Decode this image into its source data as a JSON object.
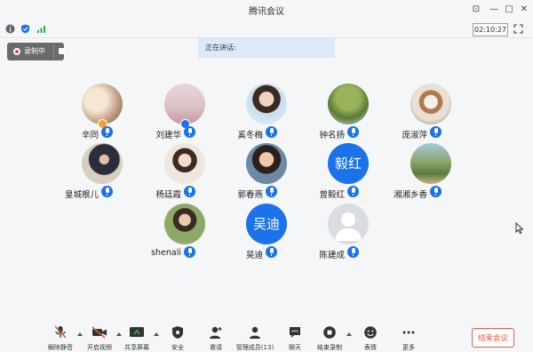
{
  "window": {
    "title": "腾讯会议"
  },
  "window_controls": {
    "pin": "⊡",
    "minimize": "—",
    "maximize": "□",
    "close": "✕"
  },
  "status": {
    "clock": "02:10:27"
  },
  "recording": {
    "label": "录制中"
  },
  "speaking": {
    "label": "正在讲话:"
  },
  "participants": [
    {
      "name": "辛同",
      "avatar": "photo",
      "muted": false,
      "badge": "host"
    },
    {
      "name": "刘建华",
      "avatar": "photo",
      "muted": false,
      "badge": "co-host"
    },
    {
      "name": "奚冬梅",
      "avatar": "photo",
      "muted": false
    },
    {
      "name": "钟名扬",
      "avatar": "photo",
      "muted": false
    },
    {
      "name": "庞淑萍",
      "avatar": "photo",
      "muted": false
    },
    {
      "name": "皇城根儿",
      "avatar": "photo",
      "muted": false
    },
    {
      "name": "杨廷霞",
      "avatar": "photo",
      "muted": false
    },
    {
      "name": "郭春燕",
      "avatar": "photo",
      "muted": false
    },
    {
      "name": "曾毅红",
      "avatar": "text",
      "avatar_text": "毅红",
      "muted": false
    },
    {
      "name": "湘湘乡香",
      "avatar": "photo",
      "muted": false
    },
    {
      "name": "shenali",
      "avatar": "photo",
      "muted": false
    },
    {
      "name": "吴迪",
      "avatar": "text",
      "avatar_text": "吴迪",
      "muted": false
    },
    {
      "name": "陈建成",
      "avatar": "default",
      "muted": false
    }
  ],
  "toolbar": {
    "unmute": "解除静音",
    "video": "开启视频",
    "share": "共享屏幕",
    "security": "安全",
    "invite": "邀请",
    "members": "管理成员(13)",
    "chat": "聊天",
    "stop_record": "结束录制",
    "reactions": "表情",
    "more": "更多",
    "end": "结束会议"
  },
  "colors": {
    "accent": "#1a73e8",
    "danger": "#e05a4f",
    "recording_bg": "#6a6a6a"
  }
}
